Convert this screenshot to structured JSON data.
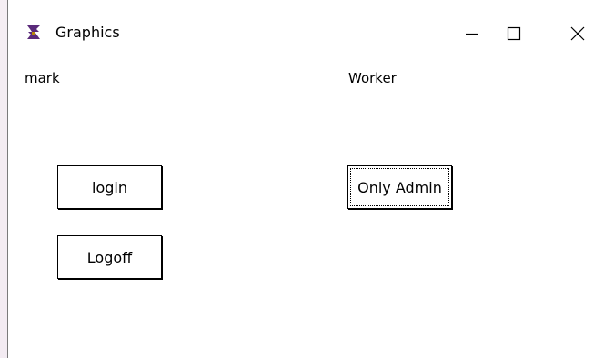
{
  "window": {
    "title": "Graphics"
  },
  "labels": {
    "left": "mark",
    "right": "Worker"
  },
  "buttons": {
    "login": "login",
    "logoff": "Logoff",
    "admin": "Only Admin"
  }
}
